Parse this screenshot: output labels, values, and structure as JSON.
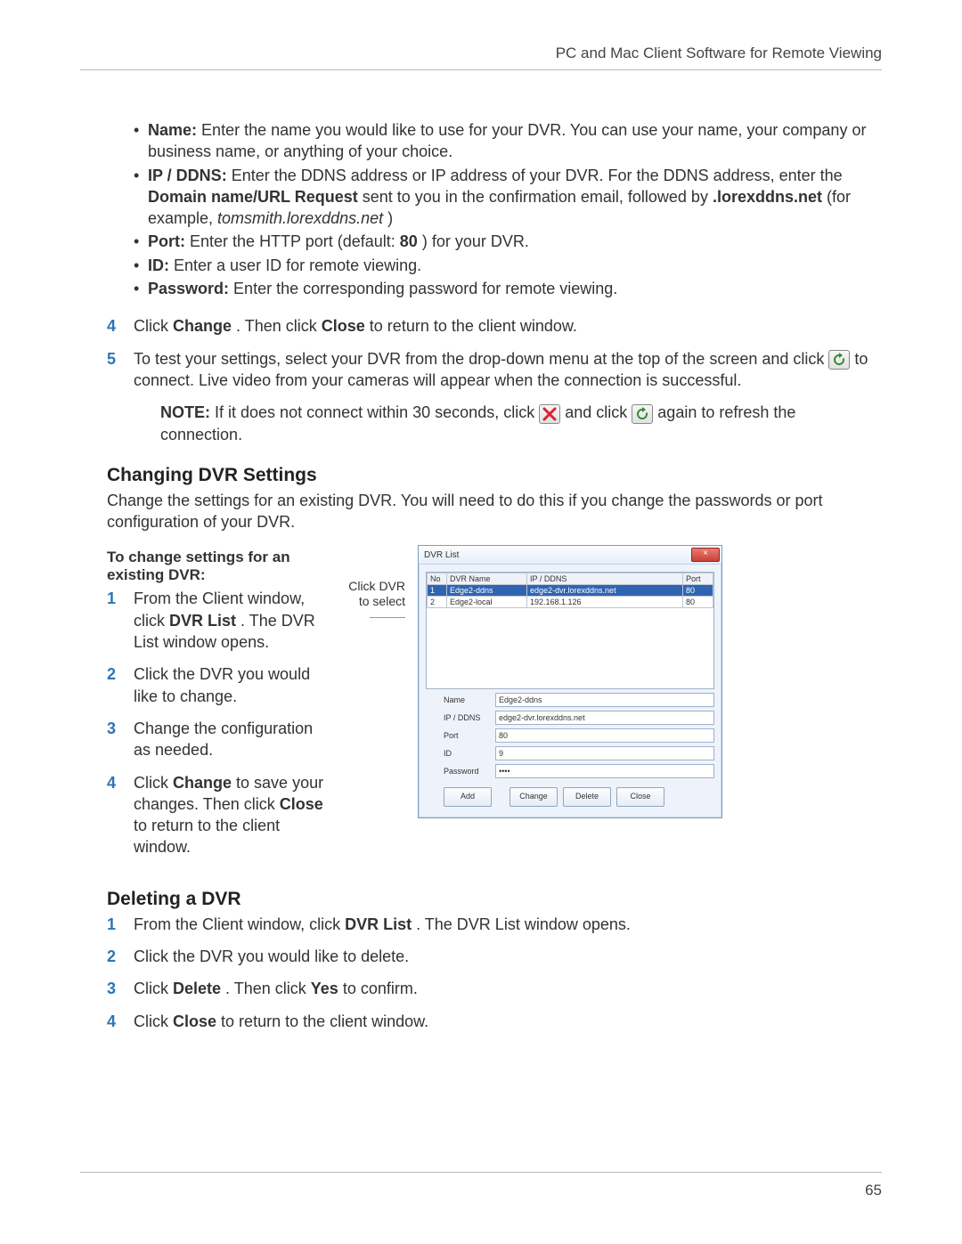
{
  "header": {
    "title": "PC and Mac Client Software for Remote Viewing"
  },
  "footer": {
    "page_number": "65"
  },
  "field_defs": {
    "name": {
      "label": "Name:",
      "text": " Enter the name you would like to use for your DVR. You can use your name, your company or business name, or anything of your choice."
    },
    "ipddns": {
      "label": "IP / DDNS:",
      "pre": " Enter the DDNS address or IP address of your DVR. For the DDNS address, enter the ",
      "bold_inline": "Domain name/URL Request",
      "mid": " sent to you in the confirmation email, followed by ",
      "bold_suffix": ".lorexddns.net",
      "example_pre": " (for example, ",
      "example_ital": "tomsmith.lorexddns.net",
      "example_post": ")"
    },
    "port": {
      "label": "Port:",
      "pre": " Enter the HTTP port (default: ",
      "bold": "80",
      "post": ") for your DVR."
    },
    "id": {
      "label": "ID:",
      "text": " Enter a user ID for remote viewing."
    },
    "password": {
      "label": "Password:",
      "text": " Enter the corresponding password for remote viewing."
    }
  },
  "steps_top": {
    "s4": {
      "num": "4",
      "pre": "Click ",
      "b1": "Change",
      "mid": ". Then click ",
      "b2": "Close",
      "post": " to return to the client window."
    },
    "s5": {
      "num": "5",
      "line1": "To test your settings, select your DVR from the drop-down menu at the top of the screen and click ",
      "line2": " to connect. Live video from your cameras will appear when the connection is successful."
    },
    "note": {
      "label": "NOTE:",
      "pre": " If it does not connect within 30 seconds, click ",
      "mid": " and click ",
      "post": " again to refresh the connection."
    }
  },
  "changing": {
    "heading": "Changing DVR Settings",
    "intro": "Change the settings for an existing DVR. You will need to do this if you change the passwords or port configuration of your DVR.",
    "subhead": "To change settings for an existing DVR:",
    "s1": {
      "num": "1",
      "pre": "From the Client window, click ",
      "b1": "DVR List",
      "post": ". The DVR List window opens."
    },
    "s2": {
      "num": "2",
      "text": "Click the DVR you would like to change."
    },
    "s3": {
      "num": "3",
      "text": "Change the configuration as needed."
    },
    "s4": {
      "num": "4",
      "pre": "Click ",
      "b1": "Change",
      "mid": " to save your changes. Then click ",
      "b2": "Close",
      "post": " to return to the client window."
    },
    "annot": {
      "line1": "Click DVR",
      "line2": "to select"
    }
  },
  "deleting": {
    "heading": "Deleting a DVR",
    "s1": {
      "num": "1",
      "pre": "From the Client window, click ",
      "b1": "DVR List",
      "post": ". The DVR List window opens."
    },
    "s2": {
      "num": "2",
      "text": "Click the DVR you would like to delete."
    },
    "s3": {
      "num": "3",
      "pre": "Click ",
      "b1": "Delete",
      "mid": ". Then click ",
      "b2": "Yes",
      "post": " to confirm."
    },
    "s4": {
      "num": "4",
      "pre": "Click ",
      "b1": "Close",
      "post": " to return to the client window."
    }
  },
  "dvr_window": {
    "title": "DVR List",
    "cols": {
      "no": "No",
      "name": "DVR Name",
      "ip": "IP / DDNS",
      "port": "Port"
    },
    "rows": [
      {
        "no": "1",
        "name": "Edge2-ddns",
        "ip": "edge2-dvr.lorexddns.net",
        "port": "80",
        "selected": true
      },
      {
        "no": "2",
        "name": "Edge2-local",
        "ip": "192.168.1.126",
        "port": "80",
        "selected": false
      }
    ],
    "form": {
      "labels": {
        "name": "Name",
        "ip": "IP / DDNS",
        "port": "Port",
        "id": "ID",
        "pw": "Password"
      },
      "values": {
        "name": "Edge2-ddns",
        "ip": "edge2-dvr.lorexddns.net",
        "port": "80",
        "id": "9",
        "pw": "••••"
      }
    },
    "buttons": {
      "add": "Add",
      "change": "Change",
      "delete": "Delete",
      "close": "Close"
    }
  }
}
